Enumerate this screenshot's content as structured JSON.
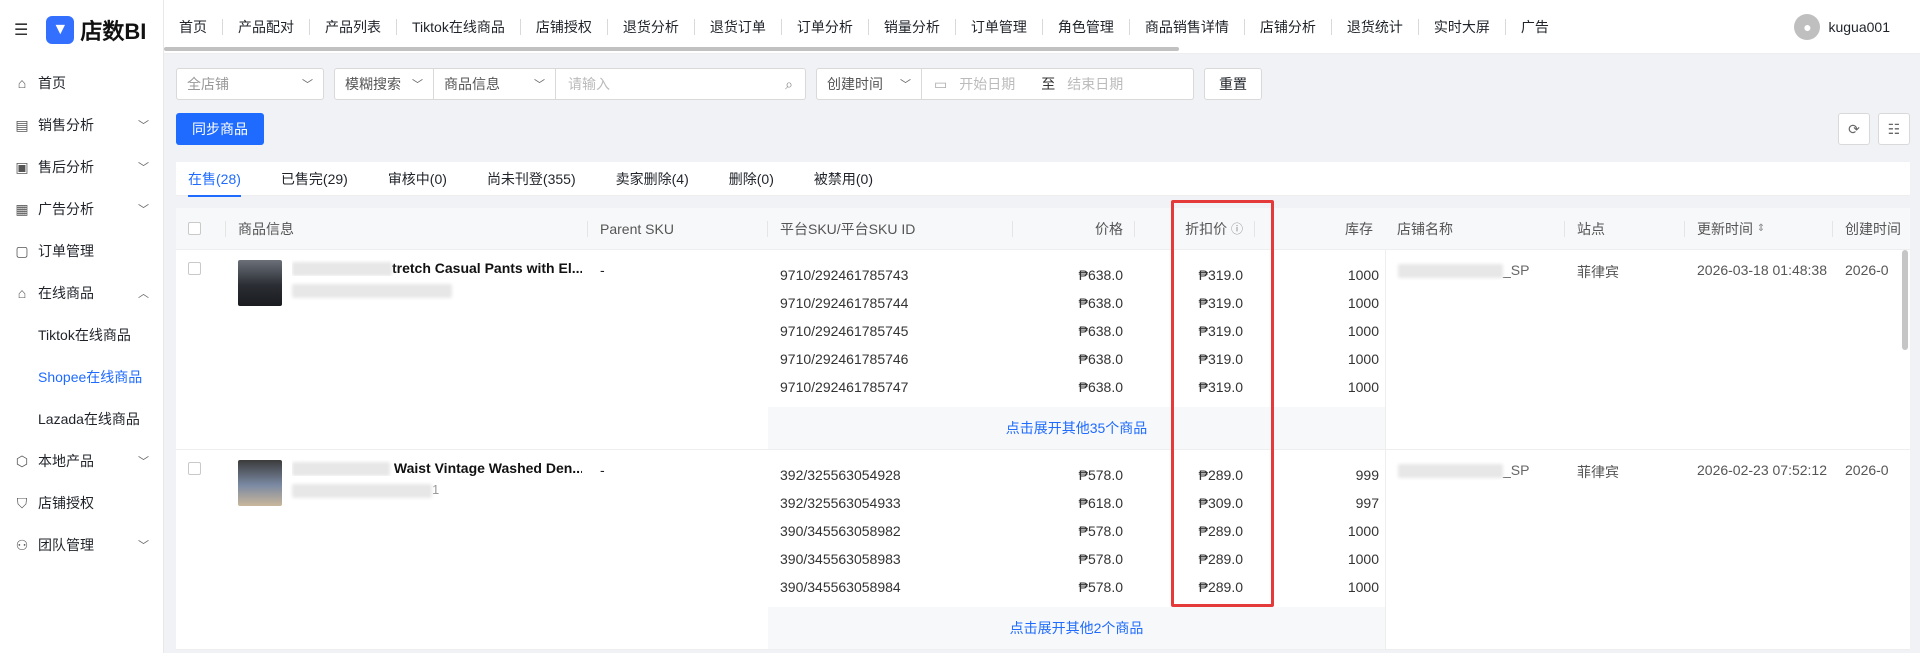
{
  "sidebar": {
    "logo": "店数BI",
    "items": [
      {
        "label": "首页",
        "icon": "home-icon",
        "chevron": ""
      },
      {
        "label": "销售分析",
        "icon": "chart-icon",
        "chevron": "⌄"
      },
      {
        "label": "售后分析",
        "icon": "afterservice-icon",
        "chevron": "⌄"
      },
      {
        "label": "广告分析",
        "icon": "ad-icon",
        "chevron": "⌄"
      },
      {
        "label": "订单管理",
        "icon": "order-icon",
        "chevron": ""
      },
      {
        "label": "在线商品",
        "icon": "store-icon",
        "chevron": "⌃"
      }
    ],
    "subitems": [
      "Tiktok在线商品",
      "Shopee在线商品",
      "Lazada在线商品"
    ],
    "items2": [
      {
        "label": "本地产品",
        "icon": "box-icon",
        "chevron": "⌄"
      },
      {
        "label": "店铺授权",
        "icon": "shield-icon",
        "chevron": ""
      },
      {
        "label": "团队管理",
        "icon": "team-icon",
        "chevron": "⌄"
      }
    ]
  },
  "topnav": {
    "items": [
      "首页",
      "产品配对",
      "产品列表",
      "Tiktok在线商品",
      "店铺授权",
      "退货分析",
      "退货订单",
      "订单分析",
      "销量分析",
      "订单管理",
      "角色管理",
      "商品销售详情",
      "店铺分析",
      "退货统计",
      "实时大屏",
      "广告"
    ],
    "user": "kugua001"
  },
  "filters": {
    "store": "全店铺",
    "search_mode": "模糊搜索",
    "field": "商品信息",
    "input_placeholder": "请输入",
    "time_field": "创建时间",
    "start_placeholder": "开始日期",
    "to": "至",
    "end_placeholder": "结束日期",
    "reset": "重置"
  },
  "actions": {
    "sync": "同步商品"
  },
  "tabs": [
    "在售(28)",
    "已售完(29)",
    "审核中(0)",
    "尚未刊登(355)",
    "卖家删除(4)",
    "删除(0)",
    "被禁用(0)"
  ],
  "table": {
    "headers": {
      "product": "商品信息",
      "parent_sku": "Parent SKU",
      "sku": "平台SKU/平台SKU ID",
      "price": "价格",
      "discount": "折扣价",
      "stock": "库存",
      "store": "店铺名称",
      "site": "站点",
      "updated": "更新时间",
      "created": "创建时间"
    },
    "rows": [
      {
        "title_visible": "tretch Casual Pants with El...",
        "parent_sku": "-",
        "store_suffix": "_SP",
        "site": "菲律宾",
        "updated": "2026-03-18 01:48:38",
        "created": "2026-0",
        "expand": "点击展开其他35个商品",
        "skus": [
          {
            "sku": "9710/292461785743",
            "price": "₱638.0",
            "discount": "₱319.0",
            "stock": "1000"
          },
          {
            "sku": "9710/292461785744",
            "price": "₱638.0",
            "discount": "₱319.0",
            "stock": "1000"
          },
          {
            "sku": "9710/292461785745",
            "price": "₱638.0",
            "discount": "₱319.0",
            "stock": "1000"
          },
          {
            "sku": "9710/292461785746",
            "price": "₱638.0",
            "discount": "₱319.0",
            "stock": "1000"
          },
          {
            "sku": "9710/292461785747",
            "price": "₱638.0",
            "discount": "₱319.0",
            "stock": "1000"
          }
        ]
      },
      {
        "title_visible": "Waist Vintage Washed Den...",
        "sub_suffix": "1",
        "parent_sku": "-",
        "store_suffix": "_SP",
        "site": "菲律宾",
        "updated": "2026-02-23 07:52:12",
        "created": "2026-0",
        "expand": "点击展开其他2个商品",
        "skus": [
          {
            "sku": "392/325563054928",
            "price": "₱578.0",
            "discount": "₱289.0",
            "stock": "999"
          },
          {
            "sku": "392/325563054933",
            "price": "₱618.0",
            "discount": "₱309.0",
            "stock": "997"
          },
          {
            "sku": "390/345563058982",
            "price": "₱578.0",
            "discount": "₱289.0",
            "stock": "1000"
          },
          {
            "sku": "390/345563058983",
            "price": "₱578.0",
            "discount": "₱289.0",
            "stock": "1000"
          },
          {
            "sku": "390/345563058984",
            "price": "₱578.0",
            "discount": "₱289.0",
            "stock": "1000"
          }
        ]
      }
    ]
  },
  "colors": {
    "accent": "#1f6bff",
    "highlight": "#e53a3a"
  }
}
